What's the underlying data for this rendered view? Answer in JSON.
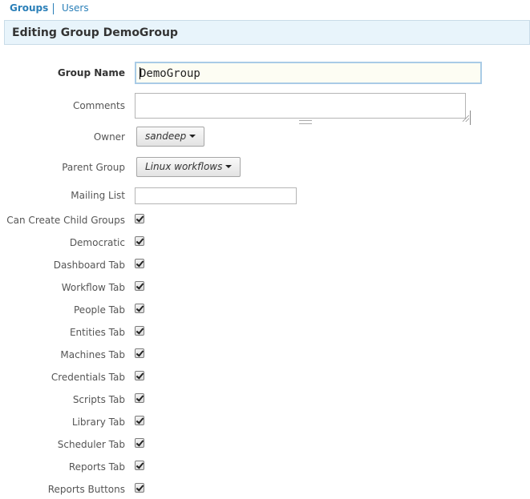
{
  "nav": {
    "groups_label": "Groups",
    "users_label": "Users"
  },
  "header": {
    "title": "Editing Group DemoGroup"
  },
  "form": {
    "group_name": {
      "label": "Group Name",
      "value": "DemoGroup"
    },
    "comments": {
      "label": "Comments",
      "value": ""
    },
    "owner": {
      "label": "Owner",
      "selected": "sandeep"
    },
    "parent_group": {
      "label": "Parent Group",
      "selected": "Linux workflows"
    },
    "mailing_list": {
      "label": "Mailing List",
      "value": ""
    },
    "checkboxes": [
      {
        "label": "Can Create Child Groups",
        "checked": true
      },
      {
        "label": "Democratic",
        "checked": true
      },
      {
        "label": "Dashboard Tab",
        "checked": true
      },
      {
        "label": "Workflow Tab",
        "checked": true
      },
      {
        "label": "People Tab",
        "checked": true
      },
      {
        "label": "Entities Tab",
        "checked": true
      },
      {
        "label": "Machines Tab",
        "checked": true
      },
      {
        "label": "Credentials Tab",
        "checked": true
      },
      {
        "label": "Scripts Tab",
        "checked": true
      },
      {
        "label": "Library Tab",
        "checked": true
      },
      {
        "label": "Scheduler Tab",
        "checked": true
      },
      {
        "label": "Reports Tab",
        "checked": true
      },
      {
        "label": "Reports Buttons",
        "checked": true
      }
    ]
  },
  "colors": {
    "accent": "#2a7fb8",
    "header_bg": "#e8f4fb"
  }
}
